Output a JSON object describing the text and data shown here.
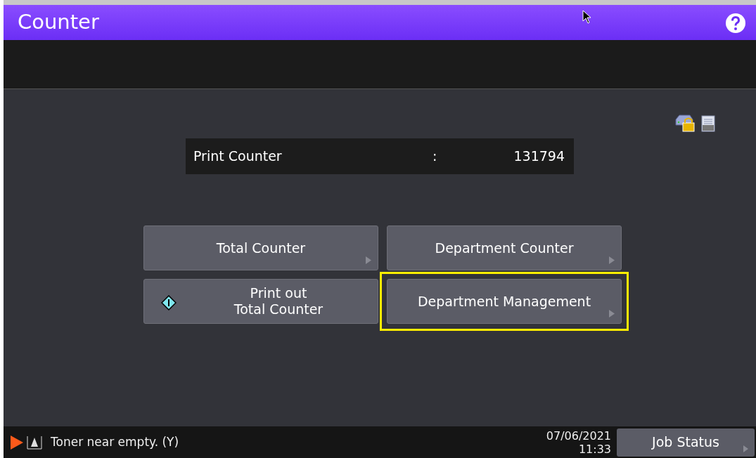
{
  "header": {
    "title": "Counter"
  },
  "counter": {
    "label": "Print Counter",
    "separator": ":",
    "value": "131794"
  },
  "buttons": [
    {
      "label": "Total Counter",
      "kind": "menu",
      "highlighted": false
    },
    {
      "label": "Department Counter",
      "kind": "menu",
      "highlighted": false
    },
    {
      "label": "Print out\nTotal Counter",
      "kind": "start",
      "highlighted": false
    },
    {
      "label": "Department Management",
      "kind": "menu",
      "highlighted": true
    }
  ],
  "status_bar": {
    "message": "Toner near empty. (Y)",
    "date": "07/06/2021",
    "time": "11:33",
    "job_button": "Job Status"
  }
}
